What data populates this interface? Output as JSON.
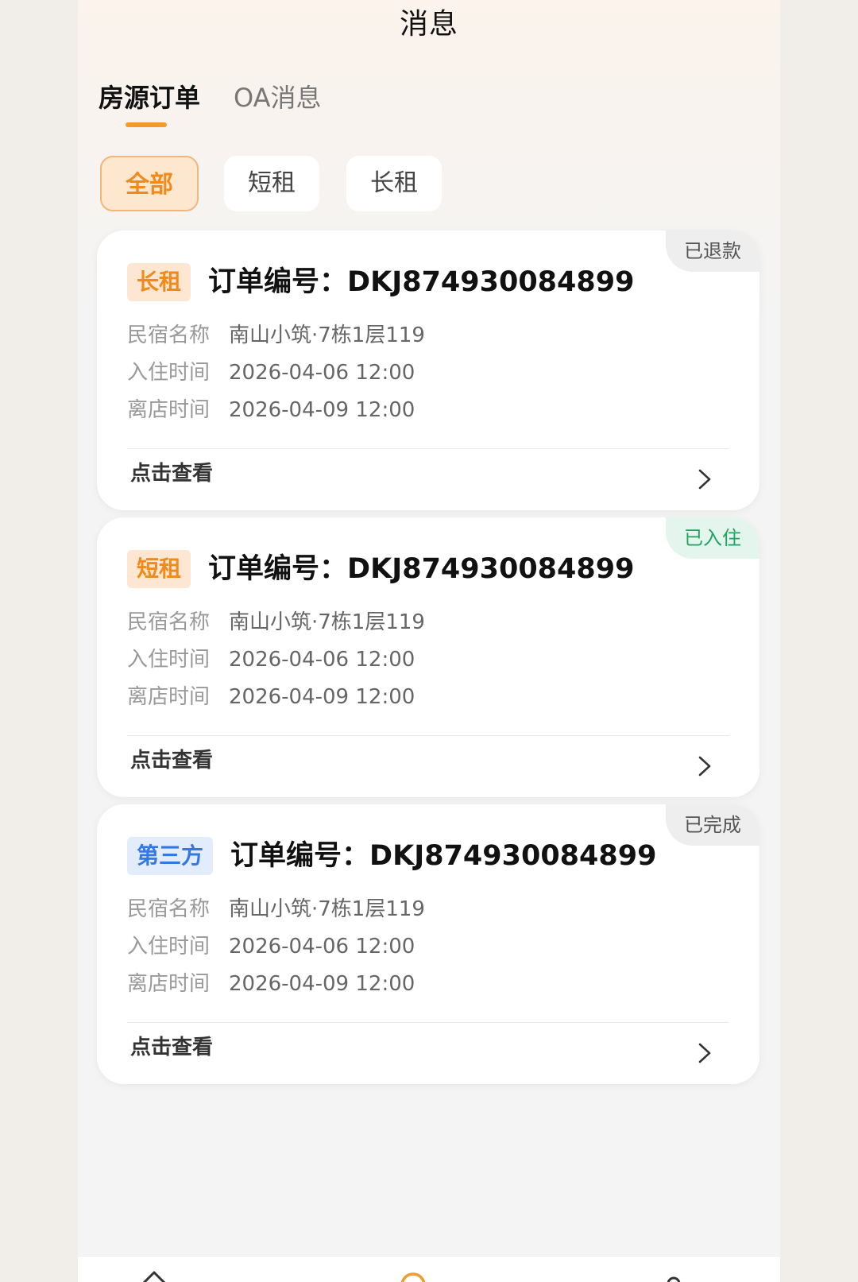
{
  "header": {
    "title": "消息"
  },
  "tabs": [
    {
      "label": "房源订单",
      "active": true
    },
    {
      "label": "OA消息",
      "active": false
    }
  ],
  "filters": [
    {
      "label": "全部",
      "active": true
    },
    {
      "label": "短租",
      "active": false
    },
    {
      "label": "长租",
      "active": false
    }
  ],
  "orders": [
    {
      "type_tag": "长租",
      "order_no": "订单编号：DKJ874930084899",
      "status": "已退款",
      "rows": [
        {
          "label": "民宿名称",
          "value": "南山小筑·7栋1层119"
        },
        {
          "label": "入住时间",
          "value": "2026-04-06  12:00"
        },
        {
          "label": "离店时间",
          "value": "2026-04-09  12:00"
        }
      ],
      "action": "点击查看"
    },
    {
      "type_tag": "短租",
      "order_no": "订单编号：DKJ874930084899",
      "status": "已入住",
      "rows": [
        {
          "label": "民宿名称",
          "value": "南山小筑·7栋1层119"
        },
        {
          "label": "入住时间",
          "value": "2026-04-06  12:00"
        },
        {
          "label": "离店时间",
          "value": "2026-04-09  12:00"
        }
      ],
      "action": "点击查看"
    },
    {
      "type_tag": "第三方",
      "order_no": "订单编号：DKJ874930084899",
      "status": "已完成",
      "rows": [
        {
          "label": "民宿名称",
          "value": "南山小筑·7栋1层119"
        },
        {
          "label": "入住时间",
          "value": "2026-04-06  12:00"
        },
        {
          "label": "离店时间",
          "value": "2026-04-09  12:00"
        }
      ],
      "action": "点击查看"
    }
  ],
  "bottom_nav": {
    "icons": [
      "home-icon",
      "message-icon",
      "profile-icon"
    ],
    "active_color": "#f39a2c"
  },
  "colors": {
    "accent": "#f39a2c",
    "status_green": "#21a45f",
    "tag_blue": "#3478e3"
  }
}
